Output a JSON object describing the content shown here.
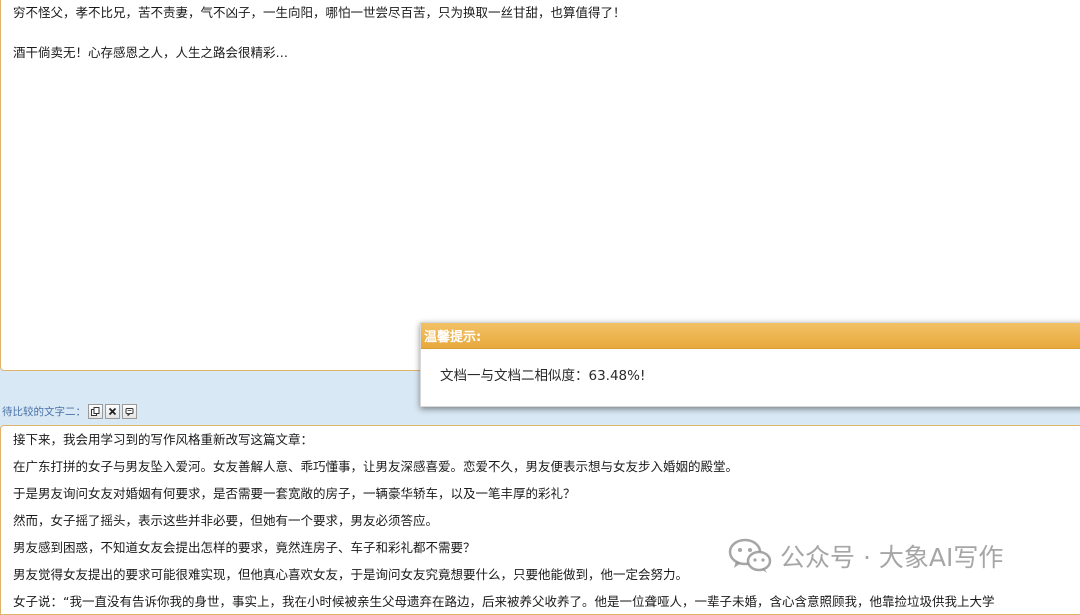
{
  "top_panel": {
    "lines": [
      "穷不怪父，孝不比兄，苦不责妻，气不凶子，一生向阳，哪怕一世尝尽百苦，只为换取一丝甘甜，也算值得了！",
      "",
      "酒干倘卖无！心存感恩之人，人生之路会很精彩…"
    ]
  },
  "compare_label": {
    "text": "待比较的文字二：",
    "buttons": [
      {
        "icon": "copy-icon"
      },
      {
        "icon": "clear-icon"
      },
      {
        "icon": "paste-icon"
      }
    ]
  },
  "bottom_panel": {
    "lines": [
      "接下来，我会用学习到的写作风格重新改写这篇文章：",
      "在广东打拼的女子与男友坠入爱河。女友善解人意、乖巧懂事，让男友深感喜爱。恋爱不久，男友便表示想与女友步入婚姻的殿堂。",
      "于是男友询问女友对婚姻有何要求，是否需要一套宽敞的房子，一辆豪华轿车，以及一笔丰厚的彩礼？",
      "然而，女子摇了摇头，表示这些并非必要，但她有一个要求，男友必须答应。",
      "男友感到困惑，不知道女友会提出怎样的要求，竟然连房子、车子和彩礼都不需要？",
      "男友觉得女友提出的要求可能很难实现，但他真心喜欢女友，于是询问女友究竟想要什么，只要他能做到，他一定会努力。",
      "女子说：“我一直没有告诉你我的身世，事实上，我在小时候被亲生父母遗弃在路边，后来被养父收养了。他是一位聋哑人，一辈子未婚，含心含意照顾我，他靠捡垃圾供我上大学"
    ]
  },
  "dialog": {
    "title": "温馨提示:",
    "message": "文档一与文档二相似度：63.48%!"
  },
  "watermark": {
    "text": "公众号 · 大象AI写作",
    "icon": "wechat-icon"
  },
  "colors": {
    "accent": "#e8a93d",
    "page_bg": "#d8e8f4",
    "label_text": "#4a73a8"
  }
}
